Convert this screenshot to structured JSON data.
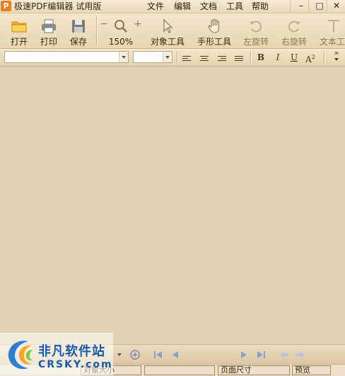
{
  "window": {
    "title": "极速PDF编辑器 试用版",
    "logo_letter": "P",
    "controls": {
      "minimize": "–",
      "maximize": "□",
      "close": "✕"
    }
  },
  "menu": [
    "文件",
    "编辑",
    "文档",
    "工具",
    "帮助"
  ],
  "toolbar": {
    "open": "打开",
    "print": "打印",
    "save": "保存",
    "zoom_minus": "−",
    "zoom_plus": "+",
    "zoom_level": "150%",
    "object_tool": "对象工具",
    "hand_tool": "手形工具",
    "rotate_left": "左旋转",
    "rotate_right": "右旋转",
    "text_tool": "文本工"
  },
  "format": {
    "font_name": "",
    "font_size": "",
    "bold": "B",
    "italic": "I",
    "underline": "U",
    "superscript": "A",
    "superscript_mark": "2",
    "more": "»"
  },
  "status": {
    "object_size": "对象大小",
    "page_size": "页面尺寸",
    "preview": "预览"
  },
  "watermark": {
    "title": "非凡软件站",
    "subtitle": "CRSKY.com"
  },
  "colors": {
    "accent": "#f07a14",
    "canvas": "#e0d0b4",
    "watermark": "#1a5aa8"
  }
}
